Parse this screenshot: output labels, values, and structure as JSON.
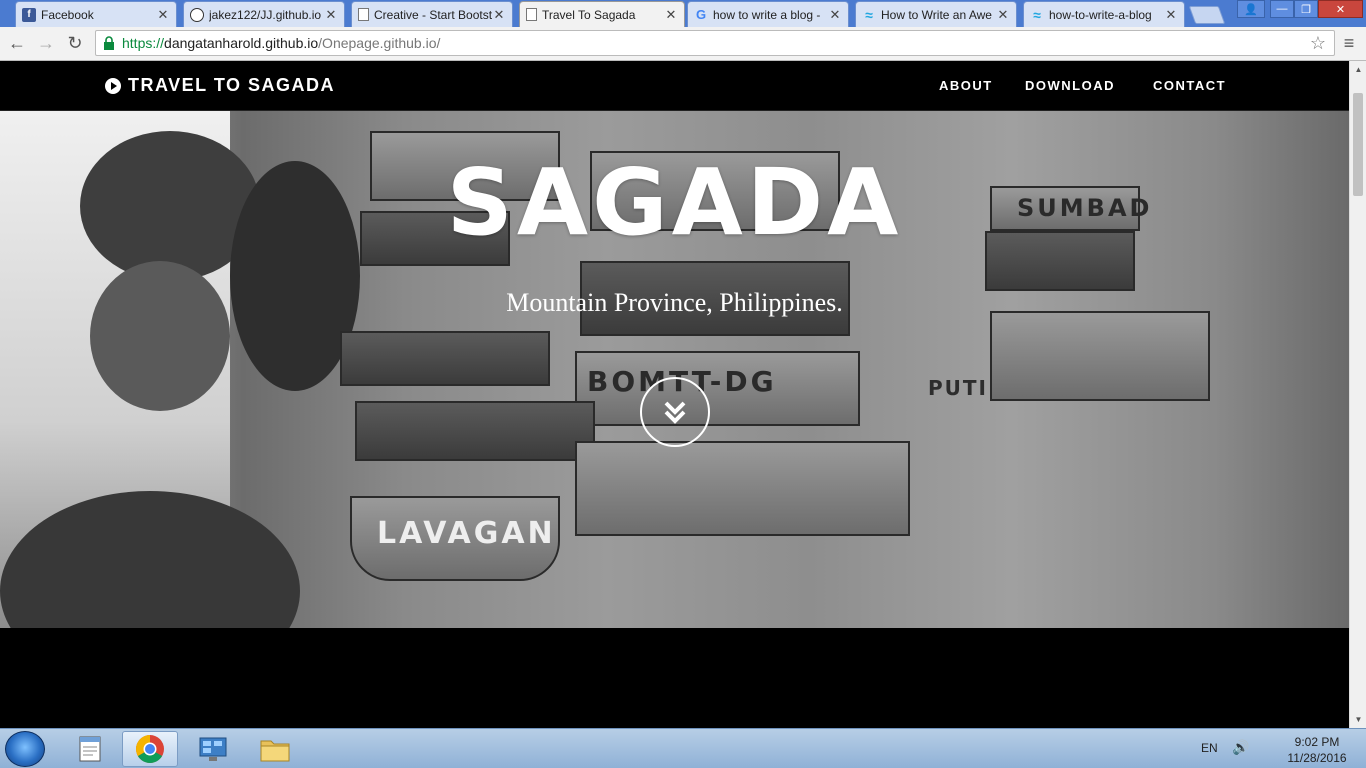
{
  "browser": {
    "tabs": [
      {
        "title": "Facebook",
        "icon": "facebook-icon"
      },
      {
        "title": "jakez122/JJ.github.io",
        "icon": "github-icon"
      },
      {
        "title": "Creative - Start Bootst",
        "icon": "document-icon"
      },
      {
        "title": "Travel To Sagada",
        "icon": "document-icon",
        "active": true
      },
      {
        "title": "how to write a blog -",
        "icon": "google-icon"
      },
      {
        "title": "How to Write an Awe",
        "icon": "wave-icon"
      },
      {
        "title": "how-to-write-a-blog",
        "icon": "wave-icon"
      }
    ],
    "url": {
      "scheme": "https://",
      "host": "dangatanharold.github.io",
      "path": "/Onepage.github.io/"
    }
  },
  "site": {
    "brand": "TRAVEL TO SAGADA",
    "nav": {
      "about": "ABOUT",
      "download": "DOWNLOAD",
      "contact": "CONTACT"
    },
    "hero": {
      "title": "SAGADA",
      "subtitle": "Mountain Province, Philippines.",
      "photo_labels": {
        "coffin1": "SUMBAD",
        "coffin2": "BOMTT-DG",
        "coffin3": "LAVAGAN",
        "cliff": "PUTI"
      }
    }
  },
  "taskbar": {
    "lang": "EN",
    "time": "9:02 PM",
    "date": "11/28/2016"
  },
  "colors": {
    "nav_bg": "#000000",
    "url_green": "#0b8a3e",
    "tab_strip": "#4b7bd0"
  }
}
